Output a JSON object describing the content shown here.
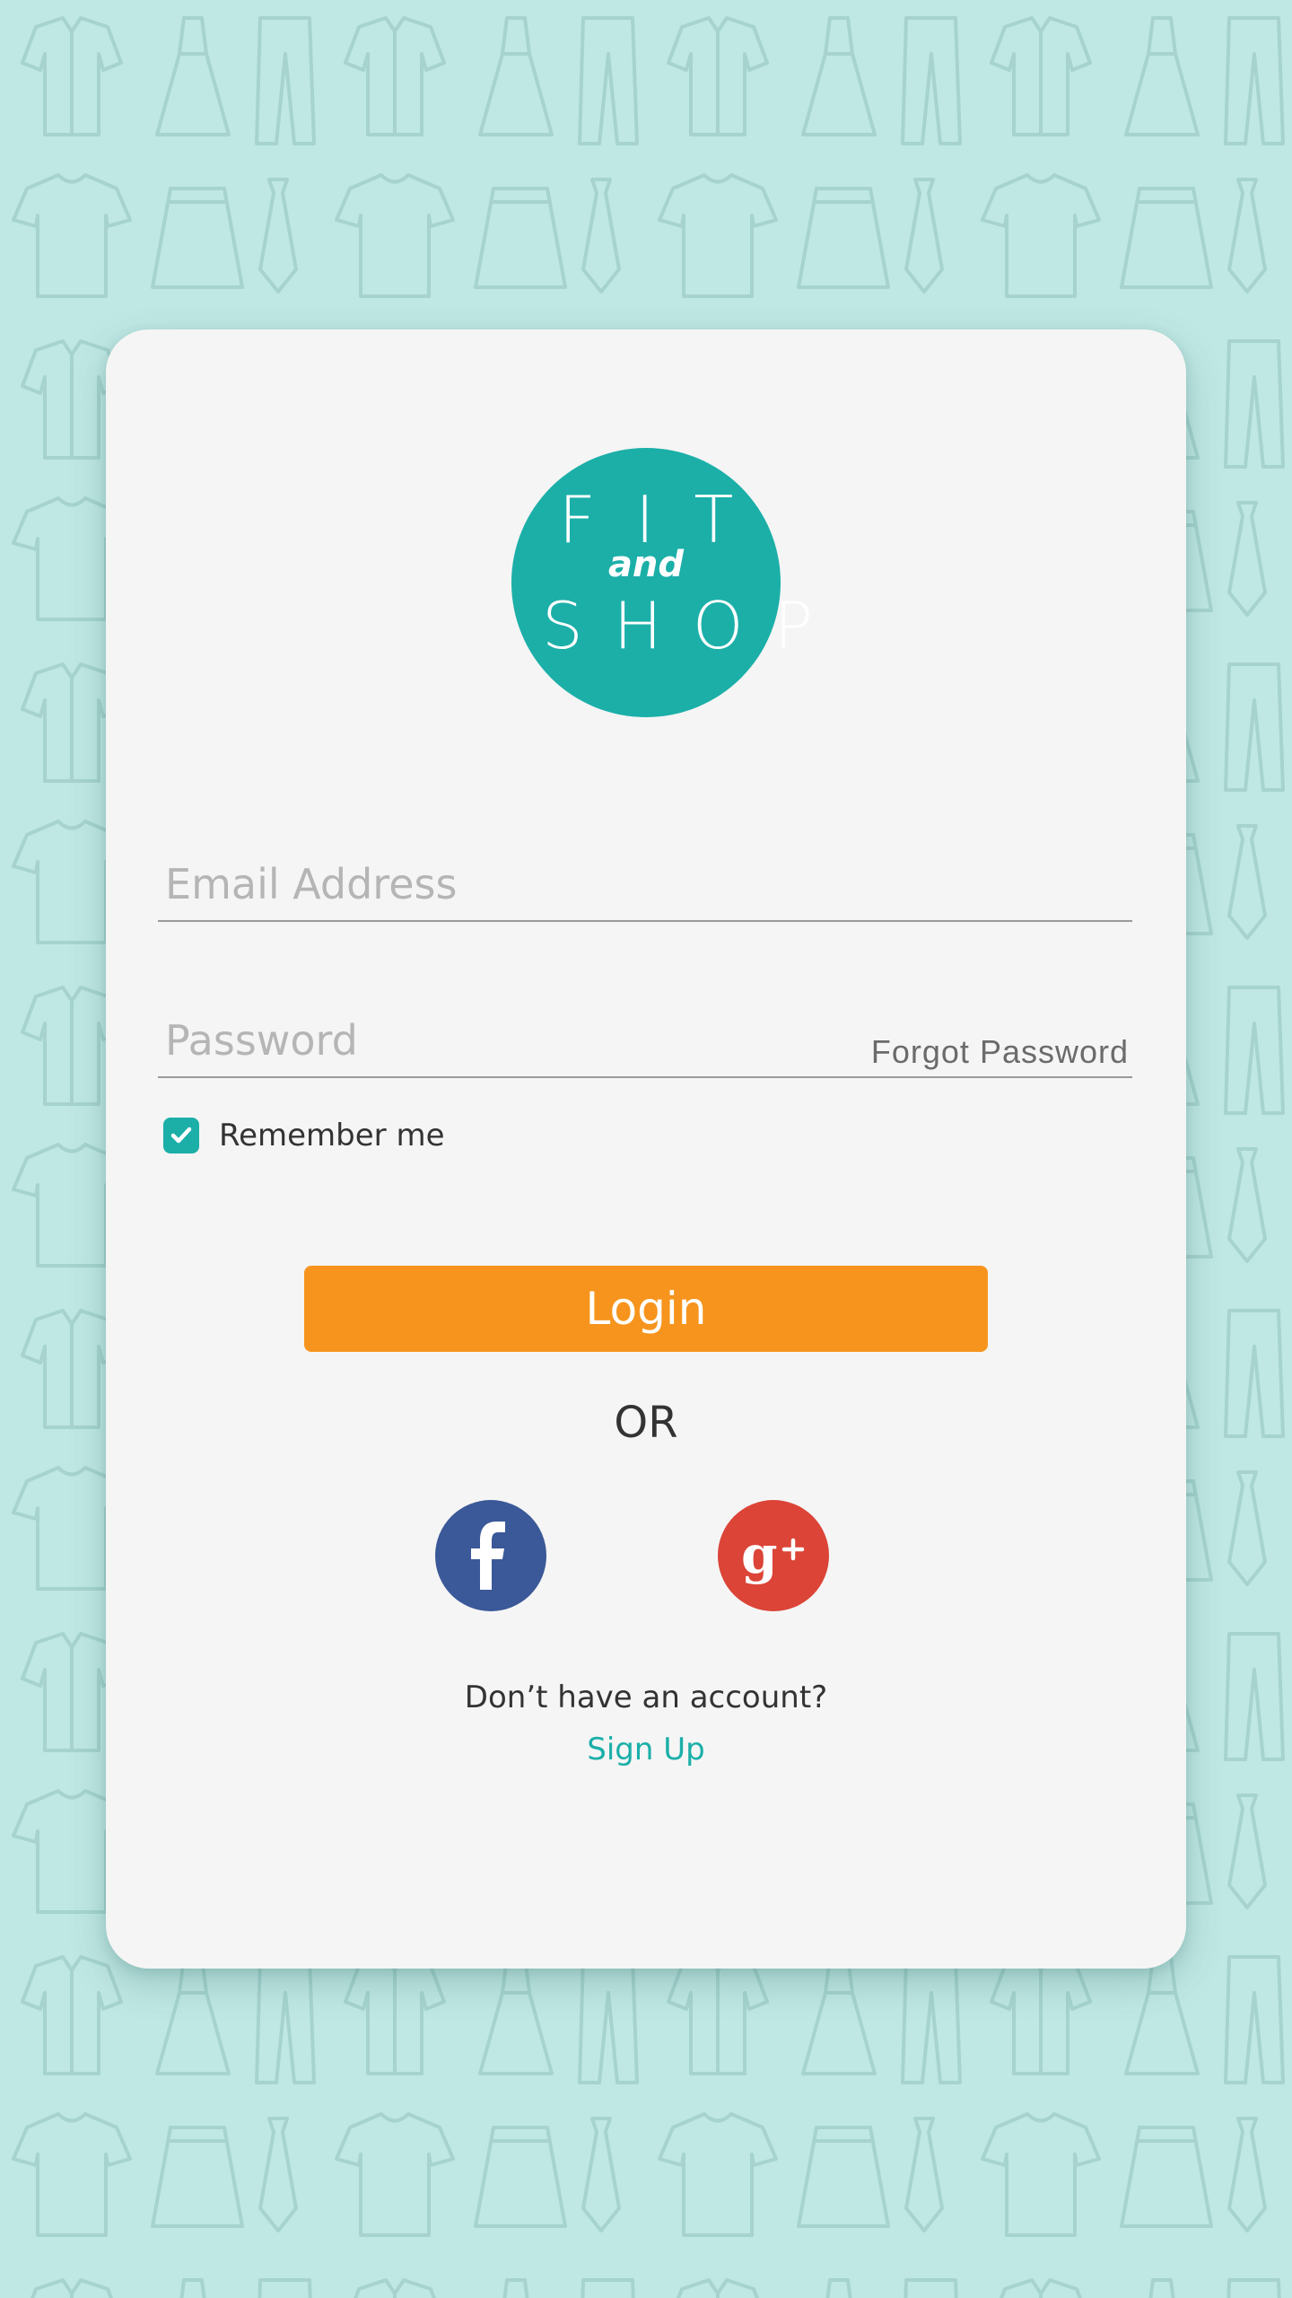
{
  "colors": {
    "background": "#bfe7e3",
    "card": "#f5f5f5",
    "accent": "#1bafa8",
    "login_button": "#f7941d",
    "facebook": "#3b5998",
    "google_plus": "#db4437"
  },
  "logo": {
    "line1": "FIT",
    "line2": "and",
    "line3": "SHOP"
  },
  "form": {
    "email_placeholder": "Email Address",
    "password_placeholder": "Password",
    "forgot_password_label": "Forgot Password",
    "remember_me_label": "Remember me",
    "remember_me_checked": true,
    "login_label": "Login"
  },
  "separator": {
    "label": "OR"
  },
  "social": {
    "facebook_icon": "facebook-icon",
    "google_plus_icon": "google-plus-icon"
  },
  "footer": {
    "no_account_text": "Don’t have an account?",
    "signup_label": "Sign Up"
  }
}
